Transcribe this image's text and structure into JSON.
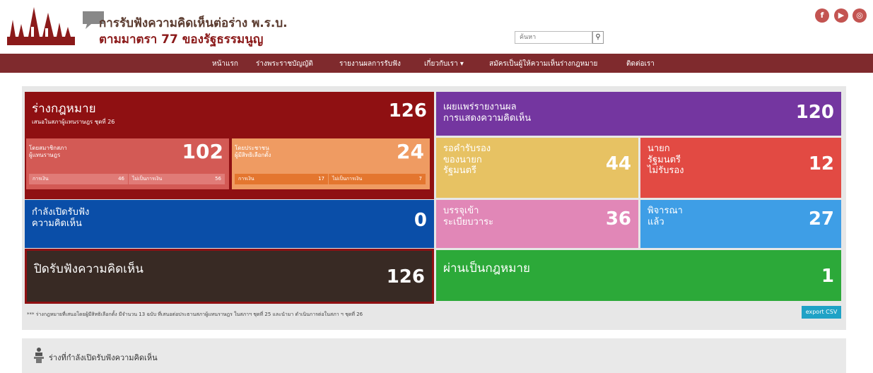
{
  "header": {
    "title_line1": "การรับฟังความคิดเห็นต่อร่าง พ.ร.บ.",
    "title_line2": "ตามมาตรา 77 ของรัฐธรรมนูญ",
    "search_placeholder": "ค้นหา",
    "social": [
      {
        "icon": "facebook-icon",
        "glyph": "f"
      },
      {
        "icon": "youtube-icon",
        "glyph": "▶"
      },
      {
        "icon": "parliament-channel-icon",
        "glyph": "◎"
      }
    ]
  },
  "nav": {
    "home": "หน้าแรก",
    "drafts": "ร่างพระราชบัญญัติ",
    "reports": "รายงานผลการรับฟัง",
    "about": "เกี่ยวกับเรา ▾",
    "register": "สมัครเป็นผู้ให้ความเห็นร่างกฎหมาย",
    "contact": "ติดต่อเรา"
  },
  "stats": {
    "draft_laws": {
      "label": "ร่างกฎหมาย",
      "sub": "เสนอในสภาผู้แทนราษฎร ชุดที่ 26",
      "value": "126"
    },
    "by_mp": {
      "label1": "โดยสมาชิกสภา",
      "label2": "ผู้แทนราษฎร",
      "value": "102",
      "finance_label": "การเงิน",
      "finance_value": "46",
      "nonfinance_label": "ไม่เป็นการเงิน",
      "nonfinance_value": "56"
    },
    "by_people": {
      "label1": "โดยประชาชน",
      "label2": "ผู้มีสิทธิเลือกตั้ง",
      "value": "24",
      "finance_label": "การเงิน",
      "finance_value": "17",
      "nonfinance_label": "ไม่เป็นการเงิน",
      "nonfinance_value": "7"
    },
    "published": {
      "label1": "เผยแพร่รายงานผล",
      "label2": "การแสดงความคิดเห็น",
      "value": "120"
    },
    "awaiting_pm": {
      "label1": "รอคำรับรอง",
      "label2": "ของนายก",
      "label3": "รัฐมนตรี",
      "value": "44"
    },
    "pm_rejected": {
      "label1": "นายก",
      "label2": "รัฐมนตรี",
      "label3": "ไม่รับรอง",
      "value": "12"
    },
    "open_hearing": {
      "label1": "กำลังเปิดรับฟัง",
      "label2": "ความคิดเห็น",
      "value": "0"
    },
    "on_agenda": {
      "label1": "บรรจุเข้า",
      "label2": "ระเบียบวาระ",
      "value": "36"
    },
    "considered": {
      "label1": "พิจารณา",
      "label2": "แล้ว",
      "value": "27"
    },
    "closed_hearing": {
      "label": "ปิดรับฟังความคิดเห็น",
      "value": "126"
    },
    "passed": {
      "label": "ผ่านเป็นกฎหมาย",
      "value": "1"
    }
  },
  "footnote": "*** ร่างกฎหมายที่เสนอโดยผู้มีสิทธิเลือกตั้ง มีจำนวน 13 ฉบับ ที่เสนอต่อประธานสภาผู้แทนราษฎร ในสภาฯ ชุดที่ 25 และนำมา ดำเนินการต่อในสภา ฯ ชุดที่ 26",
  "export_label": "export CSV",
  "open_section_title": "ร่างที่กำลังเปิดรับฟังความคิดเห็น",
  "colors": {
    "navbar": "#7f2a2d",
    "draft_laws": "#8f1012",
    "by_mp": "#d35a55",
    "by_people": "#ef9b62",
    "published": "#7436a0",
    "awaiting_pm": "#e7c263",
    "pm_rejected": "#e24a43",
    "open_hearing": "#0a4ea8",
    "on_agenda": "#e187b7",
    "considered": "#3e9ee6",
    "closed_hearing": "#382a24",
    "passed": "#2ca939",
    "export": "#1fa2c6"
  }
}
